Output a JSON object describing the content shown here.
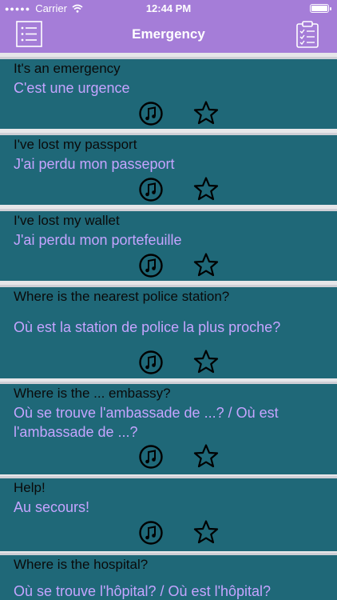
{
  "status_bar": {
    "carrier": "Carrier",
    "time": "12:44 PM"
  },
  "header": {
    "title": "Emergency",
    "left_icon": "list-icon",
    "right_icon": "clipboard-icon"
  },
  "colors": {
    "header": "#a57dd8",
    "card": "#1f6878",
    "english_text": "#0a0a0a",
    "french_text": "#c5a4ff"
  },
  "phrases": [
    {
      "english": "It's an emergency",
      "french": "C'est une urgence"
    },
    {
      "english": "I've lost my passport",
      "french": "J'ai perdu mon passeport"
    },
    {
      "english": "I've lost my wallet",
      "french": "J'ai perdu mon portefeuille"
    },
    {
      "english": "Where is the nearest police station?",
      "french": "Où est la station de police la plus proche?"
    },
    {
      "english": "Where is the ... embassy?",
      "french": "Où se trouve l'ambassade de ...? / Où est l'ambassade de ...?"
    },
    {
      "english": "Help!",
      "french": "Au secours!"
    },
    {
      "english": "Where is the hospital?",
      "french": "Où se trouve l'hôpital? / Où est l'hôpital?"
    }
  ]
}
